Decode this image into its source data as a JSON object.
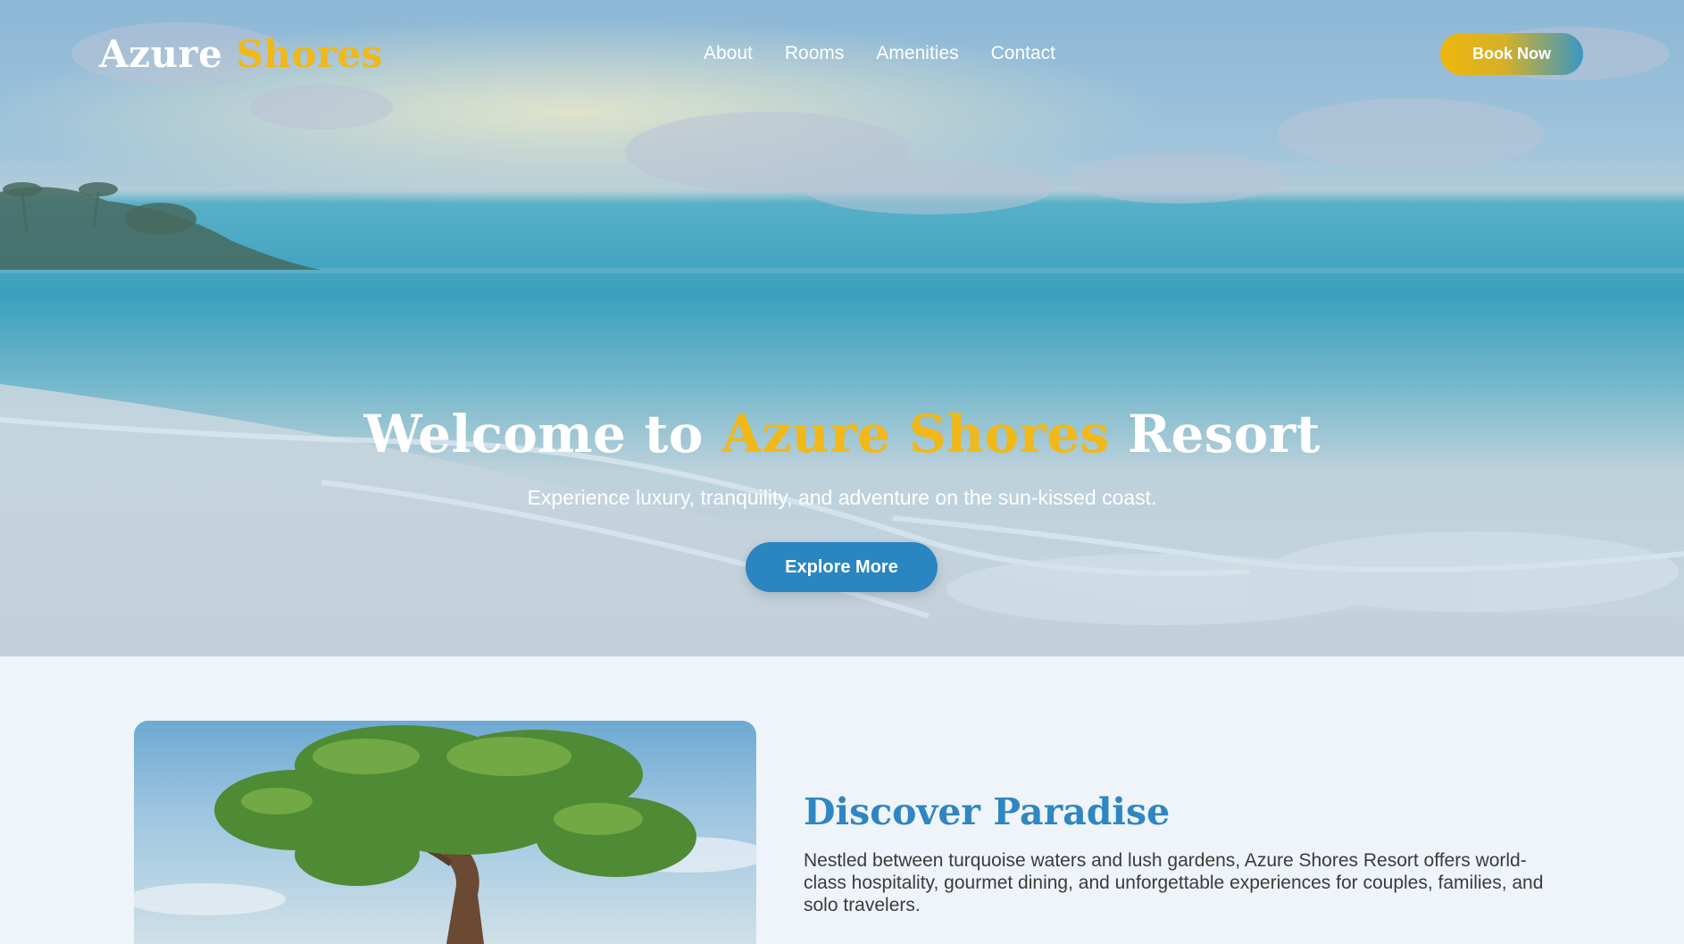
{
  "brand": {
    "name_part1": "Azure",
    "name_part2": "Shores"
  },
  "nav": {
    "items": [
      {
        "label": "About"
      },
      {
        "label": "Rooms"
      },
      {
        "label": "Amenities"
      },
      {
        "label": "Contact"
      }
    ],
    "cta_label": "Book Now"
  },
  "hero": {
    "title_prefix": "Welcome to",
    "title_accent": "Azure Shores",
    "title_suffix": "Resort",
    "subtitle": "Experience luxury, tranquility, and adventure on the sun-kissed coast.",
    "button_label": "Explore More"
  },
  "about": {
    "title": "Discover Paradise",
    "text": "Nestled between turquoise waters and lush gardens, Azure Shores Resort offers world-class hospitality, gourmet dining, and unforgettable experiences for couples, families, and solo travelers."
  },
  "colors": {
    "accent_gold": "#f0b818",
    "primary_blue": "#2b85c0",
    "heading_blue": "#2f86c0",
    "section_bg": "#eef4f9"
  }
}
